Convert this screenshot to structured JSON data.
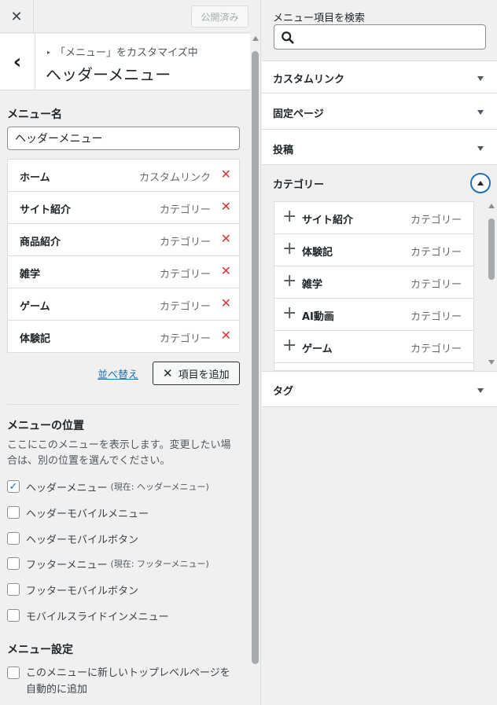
{
  "topbar": {
    "close_icon": "✕",
    "publish_label": "公開済み"
  },
  "titlebar": {
    "back_icon": "‹",
    "breadcrumb": "「メニュー」をカスタマイズ中",
    "title": "ヘッダーメニュー"
  },
  "menu_name": {
    "label": "メニュー名",
    "value": "ヘッダーメニュー"
  },
  "menu_items": [
    {
      "title": "ホーム",
      "type": "カスタムリンク"
    },
    {
      "title": "サイト紹介",
      "type": "カテゴリー"
    },
    {
      "title": "商品紹介",
      "type": "カテゴリー"
    },
    {
      "title": "雑学",
      "type": "カテゴリー"
    },
    {
      "title": "ゲーム",
      "type": "カテゴリー"
    },
    {
      "title": "体験記",
      "type": "カテゴリー"
    }
  ],
  "actions": {
    "reorder_label": "並べ替え",
    "add_items_label": "項目を追加",
    "add_items_icon": "✕",
    "remove_icon": "✕"
  },
  "locations": {
    "title": "メニューの位置",
    "description": "ここにこのメニューを表示します。変更したい場合は、別の位置を選んでください。",
    "options": [
      {
        "label": "ヘッダーメニュー",
        "note": "(現在: ヘッダーメニュー)",
        "checked": true
      },
      {
        "label": "ヘッダーモバイルメニュー",
        "note": "",
        "checked": false
      },
      {
        "label": "ヘッダーモバイルボタン",
        "note": "",
        "checked": false
      },
      {
        "label": "フッターメニュー",
        "note": "(現在: フッターメニュー)",
        "checked": false
      },
      {
        "label": "フッターモバイルボタン",
        "note": "",
        "checked": false
      },
      {
        "label": "モバイルスライドインメニュー",
        "note": "",
        "checked": false
      }
    ]
  },
  "settings": {
    "title": "メニュー設定",
    "auto_add_label_1": "このメニューに新しいトップレベルページを",
    "auto_add_label_2": "自動的に追加",
    "auto_add_checked": false
  },
  "right": {
    "search_label": "メニュー項目を検索",
    "search_value": "",
    "sections": {
      "custom_link": "カスタムリンク",
      "fixed_page": "固定ページ",
      "post": "投稿",
      "category": "カテゴリー",
      "tag": "タグ"
    },
    "category_items": [
      {
        "title": "サイト紹介",
        "type": "カテゴリー"
      },
      {
        "title": "体験記",
        "type": "カテゴリー"
      },
      {
        "title": "雑学",
        "type": "カテゴリー"
      },
      {
        "title": "AI動画",
        "type": "カテゴリー"
      },
      {
        "title": "ゲーム",
        "type": "カテゴリー"
      },
      {
        "title": "",
        "type": ""
      }
    ]
  },
  "colors": {
    "accent": "#2271b1",
    "danger": "#d63638",
    "panel_bg": "#f0f0f1",
    "border": "#dcdcde"
  }
}
